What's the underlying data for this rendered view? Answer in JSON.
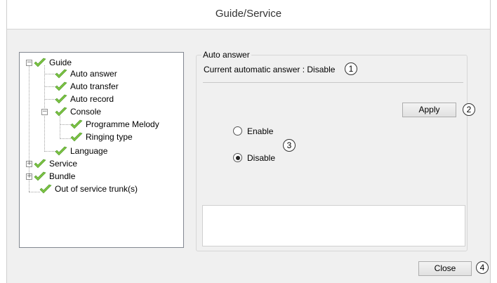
{
  "window": {
    "title": "Guide/Service"
  },
  "tree": {
    "items": [
      {
        "label": "Guide",
        "expander": "−"
      },
      {
        "label": "Auto answer"
      },
      {
        "label": "Auto transfer"
      },
      {
        "label": "Auto record"
      },
      {
        "label": "Console",
        "expander": "−"
      },
      {
        "label": "Programme Melody"
      },
      {
        "label": "Ringing type"
      },
      {
        "label": "Language"
      },
      {
        "label": "Service",
        "expander": "+"
      },
      {
        "label": "Bundle",
        "expander": "+"
      },
      {
        "label": "Out of service trunk(s)"
      }
    ],
    "check_color": "#7cc243"
  },
  "group": {
    "title": "Auto answer",
    "current_text": "Current automatic answer : Disable"
  },
  "apply_label": "Apply",
  "options": [
    {
      "label": "Enable",
      "selected": false
    },
    {
      "label": "Disable",
      "selected": true
    }
  ],
  "close_label": "Close",
  "callouts": [
    "1",
    "2",
    "3",
    "4"
  ]
}
